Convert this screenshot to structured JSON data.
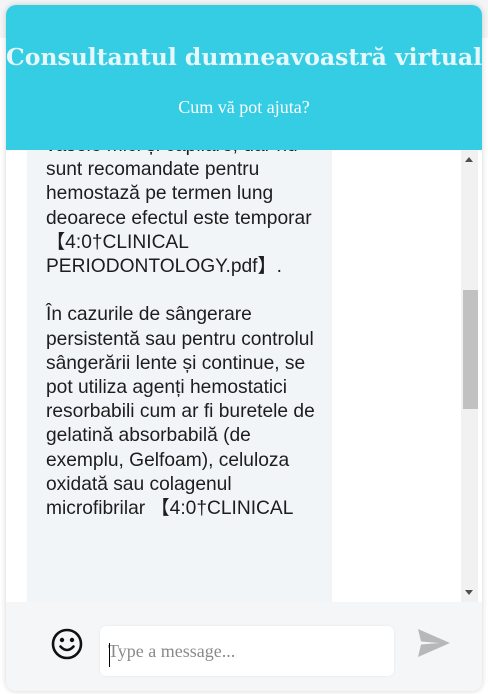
{
  "header": {
    "title": "Consultantul dumneavoastră virtual",
    "subtitle": "Cum vă pot ajuta?"
  },
  "conversation": {
    "bot_message_text": "vasele mici și capilare, dar nu sunt recomandate pentru hemostază pe termen lung deoarece efectul este temporar 【4:0†CLINICAL PERIODONTOLOGY.pdf】.\n\nÎn cazurile de sângerare persistentă sau pentru controlul sângerării lente și continue, se pot utiliza agenți hemostatici resorbabili cum ar fi buretele de gelatină absorbabilă (de exemplu, Gelfoam), celuloza oxidată sau colagenul microfibrilar 【4:0†CLINICAL"
  },
  "composer": {
    "placeholder": "Type a message...",
    "value": ""
  },
  "icons": {
    "emoji": "smiley-face-icon",
    "send": "paper-plane-send-icon"
  },
  "colors": {
    "header_bg": "#35cde3",
    "message_bubble_bg": "#f2f5f8",
    "send_icon": "#b8b8b8"
  }
}
